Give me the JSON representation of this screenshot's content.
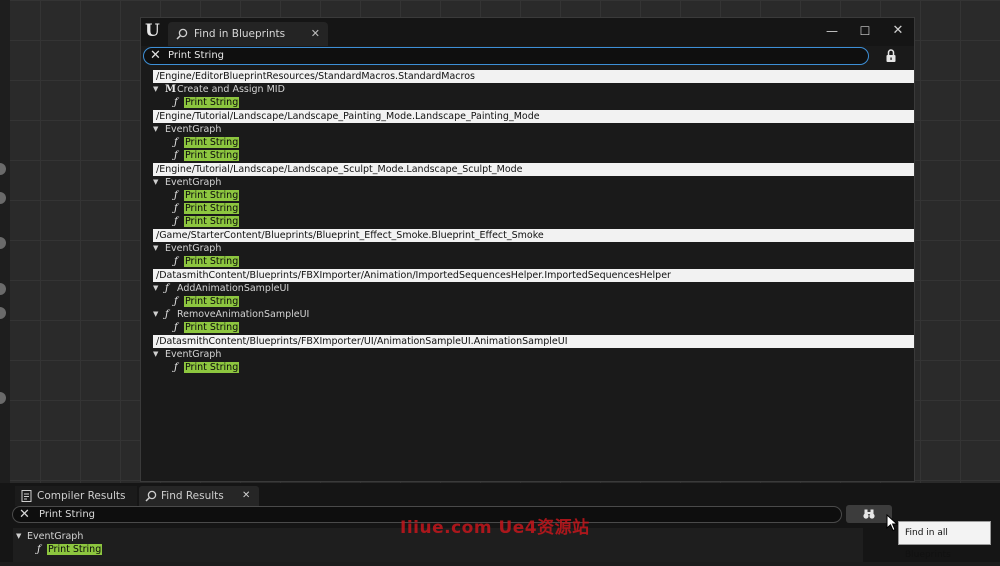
{
  "window": {
    "title": "Find in Blueprints",
    "search_value": "Print String"
  },
  "results": [
    {
      "path": "/Engine/EditorBlueprintResources/StandardMacros.StandardMacros",
      "groups": [
        {
          "label": "Create and Assign MID",
          "icon": "macro-icon",
          "items": [
            "Print String"
          ]
        }
      ]
    },
    {
      "path": "/Engine/Tutorial/Landscape/Landscape_Painting_Mode.Landscape_Painting_Mode",
      "groups": [
        {
          "label": "EventGraph",
          "icon": "",
          "items": [
            "Print String",
            "Print String"
          ]
        }
      ]
    },
    {
      "path": "/Engine/Tutorial/Landscape/Landscape_Sculpt_Mode.Landscape_Sculpt_Mode",
      "groups": [
        {
          "label": "EventGraph",
          "icon": "",
          "items": [
            "Print String",
            "Print String",
            "Print String"
          ]
        }
      ]
    },
    {
      "path": "/Game/StarterContent/Blueprints/Blueprint_Effect_Smoke.Blueprint_Effect_Smoke",
      "groups": [
        {
          "label": "EventGraph",
          "icon": "",
          "items": [
            "Print String"
          ]
        }
      ]
    },
    {
      "path": "/DatasmithContent/Blueprints/FBXImporter/Animation/ImportedSequencesHelper.ImportedSequencesHelper",
      "groups": [
        {
          "label": "AddAnimationSampleUI",
          "icon": "function-icon",
          "items": [
            "Print String"
          ]
        },
        {
          "label": "RemoveAnimationSampleUI",
          "icon": "function-icon",
          "items": [
            "Print String"
          ]
        }
      ]
    },
    {
      "path": "/DatasmithContent/Blueprints/FBXImporter/UI/AnimationSampleUI.AnimationSampleUI",
      "groups": [
        {
          "label": "EventGraph",
          "icon": "",
          "items": [
            "Print String"
          ]
        }
      ]
    }
  ],
  "bottom_panel": {
    "tabs": [
      {
        "label": "Compiler Results"
      },
      {
        "label": "Find Results"
      }
    ],
    "search_value": "Print String",
    "result_group": "EventGraph",
    "result_item": "Print String"
  },
  "tooltip": "Find in all Blueprints",
  "watermark": "Iiiue.com  Ue4资源站",
  "colors": {
    "highlight": "#8dc63f",
    "search_focus": "#3d8fd6",
    "watermark": "#c4161c"
  }
}
